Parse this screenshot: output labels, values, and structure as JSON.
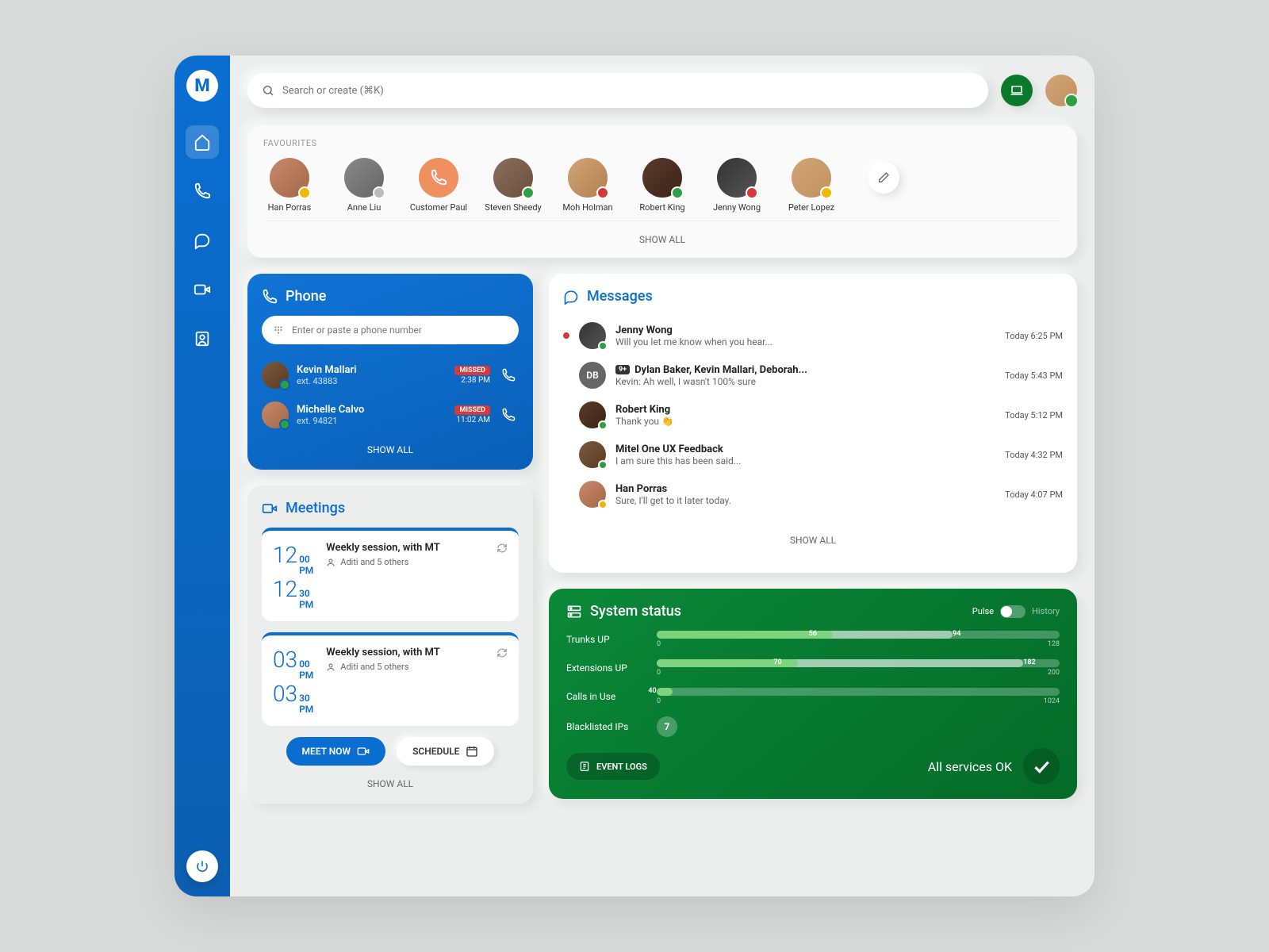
{
  "search": {
    "placeholder": "Search or create (⌘K)"
  },
  "sidebar": {
    "items": [
      "home",
      "phone",
      "messages",
      "meetings",
      "contacts"
    ]
  },
  "favourites": {
    "title": "FAVOURITES",
    "items": [
      {
        "name": "Han Porras",
        "status": "away",
        "avatar": "av1"
      },
      {
        "name": "Anne Liu",
        "status": "offline",
        "avatar": "av2"
      },
      {
        "name": "Customer Paul",
        "status": "none",
        "avatar": "solid"
      },
      {
        "name": "Steven Sheedy",
        "status": "available",
        "avatar": "av3"
      },
      {
        "name": "Moh Holman",
        "status": "busy",
        "avatar": "av4"
      },
      {
        "name": "Robert King",
        "status": "available",
        "avatar": "av5"
      },
      {
        "name": "Jenny Wong",
        "status": "dnd",
        "avatar": "av6"
      },
      {
        "name": "Peter Lopez",
        "status": "away",
        "avatar": "av7"
      }
    ],
    "show_all": "SHOW ALL"
  },
  "phone": {
    "title": "Phone",
    "input_placeholder": "Enter or paste a phone number",
    "calls": [
      {
        "name": "Kevin Mallari",
        "ext": "ext. 43883",
        "missed": "MISSED",
        "time": "2:38 PM"
      },
      {
        "name": "Michelle Calvo",
        "ext": "ext. 94821",
        "missed": "MISSED",
        "time": "11:02 AM"
      }
    ],
    "show_all": "SHOW ALL"
  },
  "meetings": {
    "title": "Meetings",
    "items": [
      {
        "start_h": "12",
        "start_m": "00",
        "start_ap": "PM",
        "end_h": "12",
        "end_m": "30",
        "end_ap": "PM",
        "title": "Weekly session, with MT",
        "attendees": "Aditi and 5 others"
      },
      {
        "start_h": "03",
        "start_m": "00",
        "start_ap": "PM",
        "end_h": "03",
        "end_m": "30",
        "end_ap": "PM",
        "title": "Weekly session, with MT",
        "attendees": "Aditi and 5 others"
      }
    ],
    "meet_now": "MEET NOW",
    "schedule": "SCHEDULE",
    "show_all": "SHOW ALL"
  },
  "messages": {
    "title": "Messages",
    "items": [
      {
        "from": "Jenny Wong",
        "preview": "Will you let me know when you hear...",
        "time": "Today 6:25 PM",
        "unread": true,
        "avatar": "av6",
        "status": "available"
      },
      {
        "from": "Dylan Baker, Kevin Mallari, Deborah...",
        "preview": "Kevin: Ah well, I wasn't 100% sure",
        "time": "Today 5:43 PM",
        "unread": false,
        "avatar": "db",
        "initials": "DB",
        "count": "9+"
      },
      {
        "from": "Robert King",
        "preview": "Thank you 👏",
        "time": "Today 5:12 PM",
        "unread": false,
        "avatar": "av5",
        "status": "available"
      },
      {
        "from": "Mitel One UX Feedback",
        "preview": "I am sure this has been said...",
        "time": "Today 4:32 PM",
        "unread": false,
        "avatar": "av8",
        "status": "available"
      },
      {
        "from": "Han Porras",
        "preview": "Sure, I'll get to it later today.",
        "time": "Today 4:07 PM",
        "unread": false,
        "avatar": "av1",
        "status": "away"
      }
    ],
    "show_all": "SHOW ALL"
  },
  "status": {
    "title": "System status",
    "pulse": "Pulse",
    "history": "History",
    "rows": [
      {
        "label": "Trunks UP",
        "val1": 56,
        "val2": 94,
        "max": 128
      },
      {
        "label": "Extensions UP",
        "val1": 70,
        "val2": 182,
        "max": 200
      },
      {
        "label": "Calls in Use",
        "val1": 40,
        "val2": null,
        "max": 1024
      }
    ],
    "blacklisted_label": "Blacklisted IPs",
    "blacklisted_count": "7",
    "event_logs": "EVENT LOGS",
    "ok_text": "All services OK"
  }
}
